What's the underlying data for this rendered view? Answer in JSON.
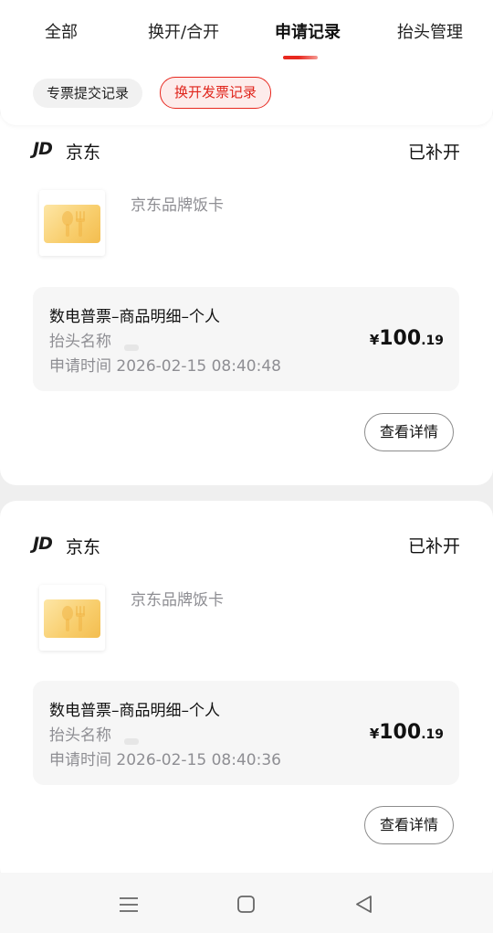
{
  "tabs": [
    {
      "label": "全部"
    },
    {
      "label": "换开/合开"
    },
    {
      "label": "申请记录",
      "active": true
    },
    {
      "label": "抬头管理"
    }
  ],
  "filters": [
    {
      "label": "专票提交记录"
    },
    {
      "label": "换开发票记录",
      "active": true
    }
  ],
  "colors": {
    "accent": "#e8281f",
    "chip_active_bg": "#fdeceb",
    "muted_text": "#8e8e93"
  },
  "records": [
    {
      "shop_logo": "JD",
      "shop_name": "京东",
      "status": "已补开",
      "product_name": "京东品牌饭卡",
      "product_icon": "gift-card-icon",
      "invoice_title": "数电普票–商品明细–个人",
      "header_label": "抬头名称",
      "apply_time_label": "申请时间",
      "apply_time": "2026-02-15 08:40:48",
      "price_currency": "¥",
      "price_int": "100",
      "price_dec": ".19",
      "detail_button": "查看详情"
    },
    {
      "shop_logo": "JD",
      "shop_name": "京东",
      "status": "已补开",
      "product_name": "京东品牌饭卡",
      "product_icon": "gift-card-icon",
      "invoice_title": "数电普票–商品明细–个人",
      "header_label": "抬头名称",
      "apply_time_label": "申请时间",
      "apply_time": "2026-02-15 08:40:36",
      "price_currency": "¥",
      "price_int": "100",
      "price_dec": ".19",
      "detail_button": "查看详情"
    }
  ],
  "nav": {
    "menu_icon": "menu-icon",
    "home_icon": "home-icon",
    "back_icon": "back-icon"
  }
}
